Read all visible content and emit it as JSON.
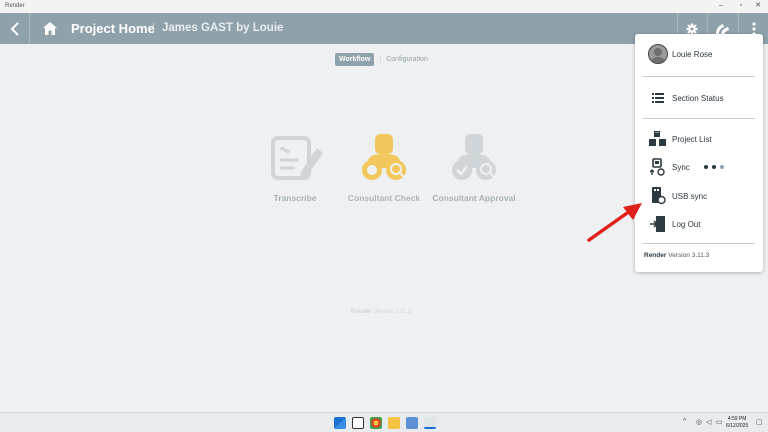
{
  "window": {
    "title": "Render",
    "controls": {
      "minimize": "–",
      "maximize": "▫",
      "close": "✕"
    }
  },
  "header": {
    "title": "Project Home",
    "separator": "|",
    "subtitle": "James GAST by Louie",
    "icons": [
      "back-icon",
      "home-icon",
      "gear-icon",
      "peer-check-icon",
      "kebab-menu-icon"
    ]
  },
  "tabs": [
    {
      "label": "Workflow",
      "active": true
    },
    {
      "label": "Configuration",
      "active": false
    }
  ],
  "tab_separator": "|",
  "steps": [
    {
      "label": "Transcribe",
      "icon": "transcribe-icon",
      "color": "#c9d0d4"
    },
    {
      "label": "Consultant Check",
      "icon": "consultant-check-icon",
      "color": "#f2c75c"
    },
    {
      "label": "Consultant Approval",
      "icon": "consultant-approval-icon",
      "color": "#c9d0d4"
    }
  ],
  "center_version": {
    "brand": "Render",
    "text": "Version 3.11.3"
  },
  "menu": {
    "user": "Louie Rose",
    "items": [
      {
        "label": "Section Status",
        "icon": "list-icon"
      },
      {
        "label": "Project List",
        "icon": "boxes-icon"
      },
      {
        "label": "Sync",
        "icon": "sync-icon"
      },
      {
        "label": "USB sync",
        "icon": "usb-sync-icon"
      },
      {
        "label": "Log Out",
        "icon": "logout-icon"
      }
    ],
    "version_brand": "Render",
    "version_text": "Version 3.11.3"
  },
  "taskbar": {
    "time": "4:59 PM",
    "date": "6/12/2025",
    "tray_chevron": "^"
  },
  "colors": {
    "appbar": "#8fa1ab",
    "accent_gold": "#f2c75c",
    "annotation_arrow": "#e0201b"
  }
}
